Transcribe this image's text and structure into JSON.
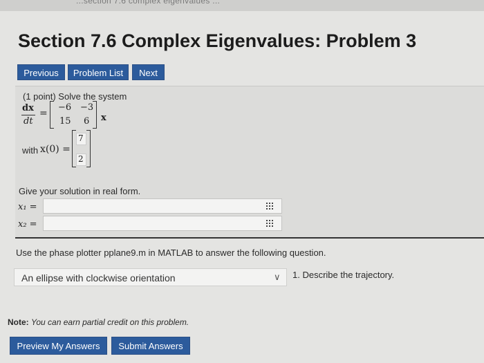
{
  "browser": {
    "tab_strip_text": "...section 7.6 complex eigenvalues ..."
  },
  "page": {
    "title": "Section 7.6 Complex Eigenvalues: Problem 3"
  },
  "nav": {
    "previous": "Previous",
    "problem_list": "Problem List",
    "next": "Next"
  },
  "problem": {
    "intro": "(1 point) Solve the system",
    "dx": "dx",
    "dt": "dt",
    "equals": "=",
    "matrix": [
      "−6",
      "−3",
      "15",
      "6"
    ],
    "vector_x": "x",
    "with_prefix": "with",
    "initial_lhs": "x(0) =",
    "initial_vector": [
      "7",
      "2"
    ],
    "instruction": "Give your solution in real form.",
    "x1_label": "x₁ =",
    "x2_label": "x₂ =",
    "x1_value": "",
    "x2_value": "",
    "phase_text": "Use the phase plotter pplane9.m in MATLAB to answer the following question.",
    "dropdown_selected": "An ellipse with clockwise orientation",
    "question_label": "1. Describe the trajectory."
  },
  "footer": {
    "note_label": "Note:",
    "note_text": "You can earn partial credit on this problem.",
    "preview_button": "Preview My Answers",
    "submit_button": "Submit Answers"
  }
}
